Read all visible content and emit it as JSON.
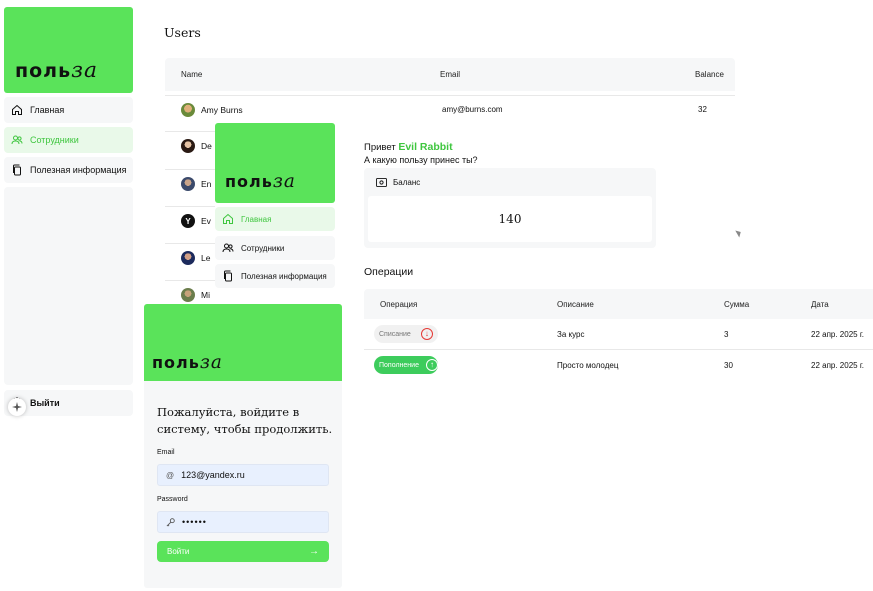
{
  "sidebar": {
    "logo_main": "поль",
    "logo_cursive": "за",
    "items": [
      {
        "label": "Главная",
        "icon": "home-icon"
      },
      {
        "label": "Сотрудники",
        "icon": "users-icon"
      },
      {
        "label": "Полезная информация",
        "icon": "copy-icon"
      }
    ],
    "logout_label": "Выйти",
    "accent": "#5ae35a"
  },
  "users": {
    "title": "Users",
    "columns": [
      "Name",
      "Email",
      "Balance"
    ],
    "rows": [
      {
        "name": "Amy Burns",
        "email": "amy@burns.com",
        "balance": "32"
      },
      {
        "name": "De"
      },
      {
        "name": "En"
      },
      {
        "name": "Ev"
      },
      {
        "name": "Le"
      },
      {
        "name": "Mi"
      }
    ]
  },
  "overlay_nav": {
    "logo_main": "поль",
    "logo_cursive": "за",
    "items": [
      {
        "label": "Главная"
      },
      {
        "label": "Сотрудники"
      },
      {
        "label": "Полезная информация"
      }
    ]
  },
  "dashboard": {
    "greeting_prefix": "Привет",
    "user_name": "Evil Rabbit",
    "subtitle": "А какую пользу принес ты?",
    "balance_label": "Баланс",
    "balance_value": "140",
    "ops_title": "Операции",
    "ops_columns": [
      "Операция",
      "Описание",
      "Сумма",
      "Дата"
    ],
    "ops_rows": [
      {
        "type": "Списание",
        "description": "За курс",
        "amount": "3",
        "date": "22 апр. 2025 г.",
        "direction": "down"
      },
      {
        "type": "Пополнение",
        "description": "Просто молодец",
        "amount": "30",
        "date": "22 апр. 2025 г.",
        "direction": "up"
      }
    ]
  },
  "login": {
    "logo_main": "поль",
    "logo_cursive": "за",
    "heading": "Пожалуйста, войдите в систему, чтобы продолжить.",
    "email_label": "Email",
    "email_value": "123@yandex.ru",
    "password_label": "Password",
    "password_value": "••••••",
    "submit_label": "Войти"
  }
}
